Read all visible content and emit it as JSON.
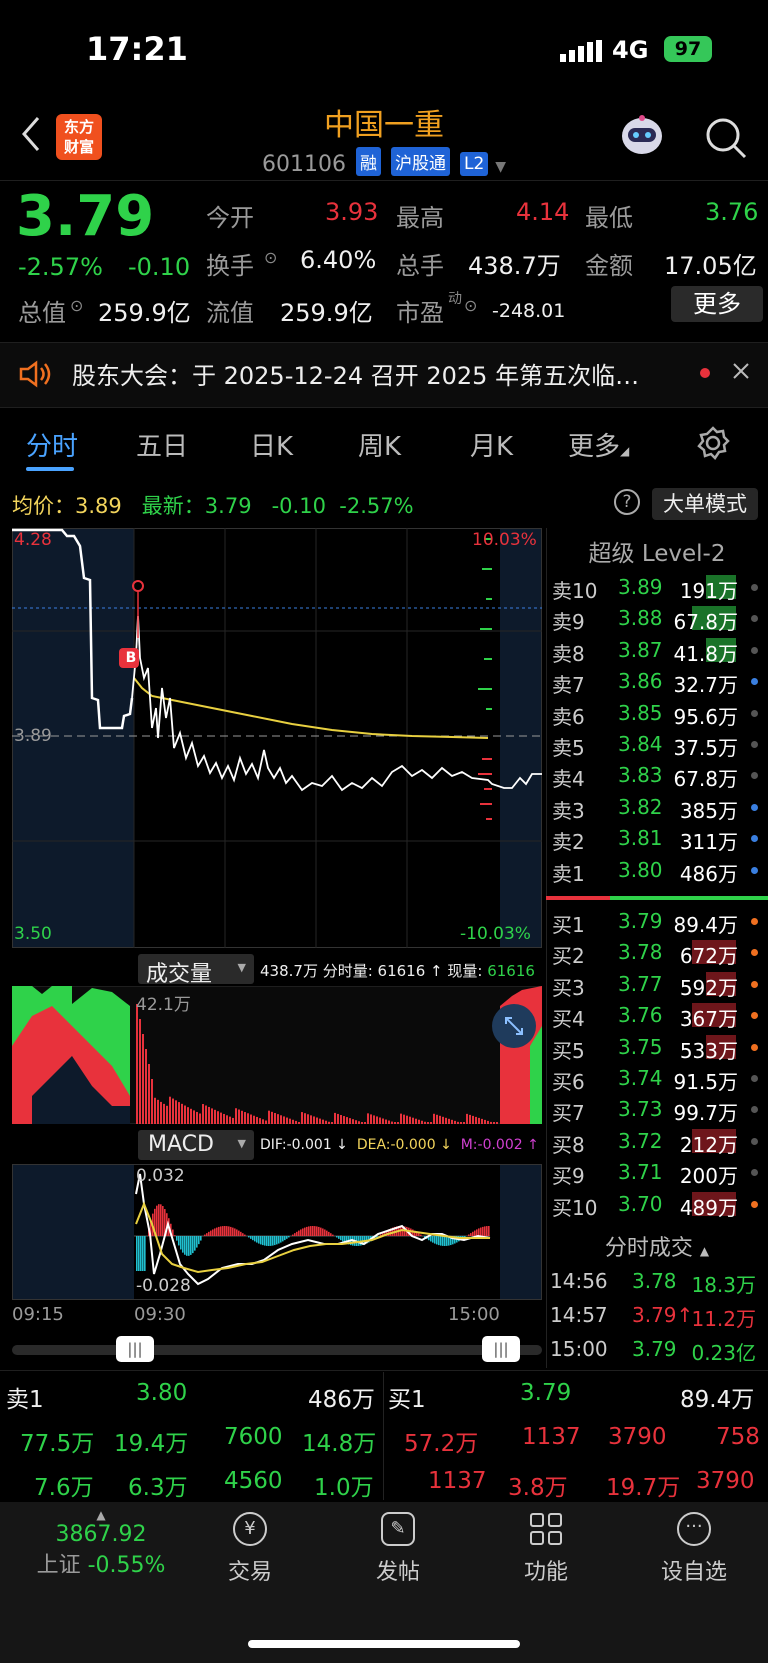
{
  "status": {
    "time": "17:21",
    "network": "4G",
    "battery": "97"
  },
  "header": {
    "title": "中国一重",
    "code": "601106",
    "tags": [
      "融",
      "沪股通",
      "L2"
    ],
    "logo_line1": "东方",
    "logo_line2": "财富"
  },
  "quote": {
    "price": "3.79",
    "change_pct": "-2.57%",
    "change": "-0.10",
    "open_label": "今开",
    "open": "3.93",
    "high_label": "最高",
    "high": "4.14",
    "low_label": "最低",
    "low": "3.76",
    "turnover_label": "换手",
    "turnover": "6.40%",
    "volume_label": "总手",
    "volume": "438.7万",
    "amount_label": "金额",
    "amount": "17.05亿",
    "mcap_label": "总值",
    "mcap": "259.9亿",
    "float_label": "流值",
    "float": "259.9亿",
    "pe_label": "市盈",
    "pe_sup": "动",
    "pe": "-248.01",
    "more": "更多"
  },
  "notice": {
    "text": "股东大会：于 2025-12-24 召开 2025 年第五次临…"
  },
  "tabs": [
    "分时",
    "五日",
    "日K",
    "周K",
    "月K",
    "更多"
  ],
  "info": {
    "avg_label": "均价：",
    "avg": "3.89",
    "latest_label": "最新：",
    "latest": "3.79",
    "chg": "-0.10",
    "pct": "-2.57%",
    "mode_button": "大单模式"
  },
  "chart": {
    "y_top": "4.28",
    "y_mid": "3.89",
    "y_bottom": "3.50",
    "pct_top": "10.03%",
    "pct_bottom": "-10.03%",
    "marker": "B",
    "vol_label": "成交量",
    "vol_info": "438.7万 分时量: 61616 ↑ 现量:",
    "vol_now": "61616",
    "vol_max": "42.1万",
    "macd_label": "MACD",
    "dif": "DIF:-0.001 ↓",
    "dea": "DEA:-0.000 ↓",
    "m": "M:-0.002 ↑",
    "macd_top": "0.032",
    "macd_bottom": "-0.028",
    "time_start": "09:15",
    "time_open": "09:30",
    "time_end": "15:00"
  },
  "orderbook": {
    "title": "超级 Level-2",
    "asks": [
      {
        "label": "卖10",
        "price": "3.89",
        "vol": "191万",
        "dot": "#555"
      },
      {
        "label": "卖9",
        "price": "3.88",
        "vol": "67.8万",
        "dot": "#555"
      },
      {
        "label": "卖8",
        "price": "3.87",
        "vol": "41.8万",
        "dot": "#555"
      },
      {
        "label": "卖7",
        "price": "3.86",
        "vol": "32.7万",
        "dot": "#3a7fe0"
      },
      {
        "label": "卖6",
        "price": "3.85",
        "vol": "95.6万",
        "dot": "#555"
      },
      {
        "label": "卖5",
        "price": "3.84",
        "vol": "37.5万",
        "dot": "#555"
      },
      {
        "label": "卖4",
        "price": "3.83",
        "vol": "67.8万",
        "dot": "#555"
      },
      {
        "label": "卖3",
        "price": "3.82",
        "vol": "385万",
        "dot": "#3a7fe0"
      },
      {
        "label": "卖2",
        "price": "3.81",
        "vol": "311万",
        "dot": "#3a7fe0"
      },
      {
        "label": "卖1",
        "price": "3.80",
        "vol": "486万",
        "dot": "#3a7fe0"
      }
    ],
    "bids": [
      {
        "label": "买1",
        "price": "3.79",
        "vol": "89.4万",
        "dot": "#f07020"
      },
      {
        "label": "买2",
        "price": "3.78",
        "vol": "672万",
        "dot": "#f07020"
      },
      {
        "label": "买3",
        "price": "3.77",
        "vol": "592万",
        "dot": "#f07020"
      },
      {
        "label": "买4",
        "price": "3.76",
        "vol": "367万",
        "dot": "#f07020"
      },
      {
        "label": "买5",
        "price": "3.75",
        "vol": "533万",
        "dot": "#f07020"
      },
      {
        "label": "买6",
        "price": "3.74",
        "vol": "91.5万",
        "dot": "#555"
      },
      {
        "label": "买7",
        "price": "3.73",
        "vol": "99.7万",
        "dot": "#555"
      },
      {
        "label": "买8",
        "price": "3.72",
        "vol": "212万",
        "dot": "#555"
      },
      {
        "label": "买9",
        "price": "3.71",
        "vol": "200万",
        "dot": "#555"
      },
      {
        "label": "买10",
        "price": "3.70",
        "vol": "489万",
        "dot": "#f07020"
      }
    ],
    "trades_title": "分时成交",
    "trades": [
      {
        "time": "14:56",
        "price": "3.78",
        "vol": "18.3万"
      },
      {
        "time": "14:57",
        "price": "3.79↑",
        "vol": "11.2万"
      },
      {
        "time": "15:00",
        "price": "3.79",
        "vol": "0.23亿"
      }
    ]
  },
  "strip": {
    "sell_label": "卖1",
    "sell_price": "3.80",
    "sell_vol": "486万",
    "buy_label": "买1",
    "buy_price": "3.79",
    "buy_vol": "89.4万",
    "sell_row1": [
      "77.5万",
      "19.4万",
      "7600",
      "14.8万"
    ],
    "sell_row2": [
      "7.6万",
      "6.3万",
      "4560",
      "1.0万"
    ],
    "buy_row1": [
      "57.2万",
      "1137",
      "3790",
      "758"
    ],
    "buy_row2": [
      "1137",
      "3.8万",
      "19.7万",
      "3790"
    ]
  },
  "bottom": {
    "index_value": "3867.92",
    "index_name": "上证",
    "index_change": "-0.55%",
    "nav": [
      "交易",
      "发帖",
      "功能",
      "设自选"
    ]
  }
}
